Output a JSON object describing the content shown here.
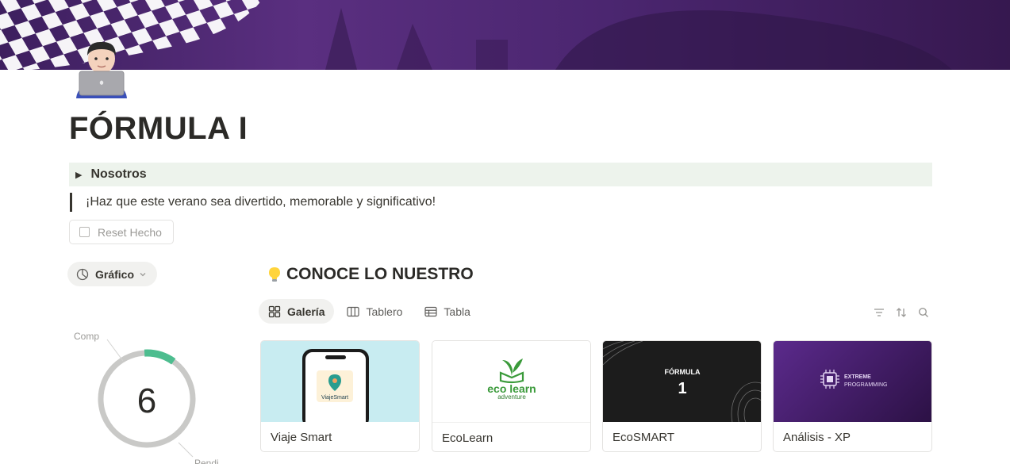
{
  "page": {
    "title": "FÓRMULA I",
    "icon": "technologist-emoji-icon"
  },
  "toggle": {
    "label": "Nosotros"
  },
  "quote": {
    "text": "¡Haz que este verano sea divertido, memorable y significativo!"
  },
  "reset_button": {
    "label": "Reset Hecho"
  },
  "chart_view": {
    "label": "Gráfico",
    "chart_data": {
      "type": "pie",
      "center_value": "6",
      "labels": [
        "Comp",
        "Pendi"
      ],
      "colors": [
        "#4dbd8f",
        "#c9c9c7"
      ]
    }
  },
  "section": {
    "title": "CONOCE LO NUESTRO",
    "icon": "lightbulb-icon"
  },
  "tabs": [
    {
      "label": "Galería",
      "icon": "gallery-icon"
    },
    {
      "label": "Tablero",
      "icon": "board-icon"
    },
    {
      "label": "Tabla",
      "icon": "table-icon"
    }
  ],
  "gallery": [
    {
      "name": "Viaje Smart",
      "cover_text": "ViajeSmart",
      "cover_color": "#c8ecf1"
    },
    {
      "name": "EcoLearn",
      "cover_text_1": "eco learn",
      "cover_text_2": "adventure",
      "cover_color": "#ffffff"
    },
    {
      "name": "EcoSMART",
      "cover_text_1": "FÓRMULA",
      "cover_text_2": "1",
      "cover_color": "#1c1c1c"
    },
    {
      "name": "Análisis - XP",
      "cover_text_1": "EXTREME",
      "cover_text_2": "PROGRAMMING",
      "cover_color": "#3e1a5e"
    }
  ]
}
